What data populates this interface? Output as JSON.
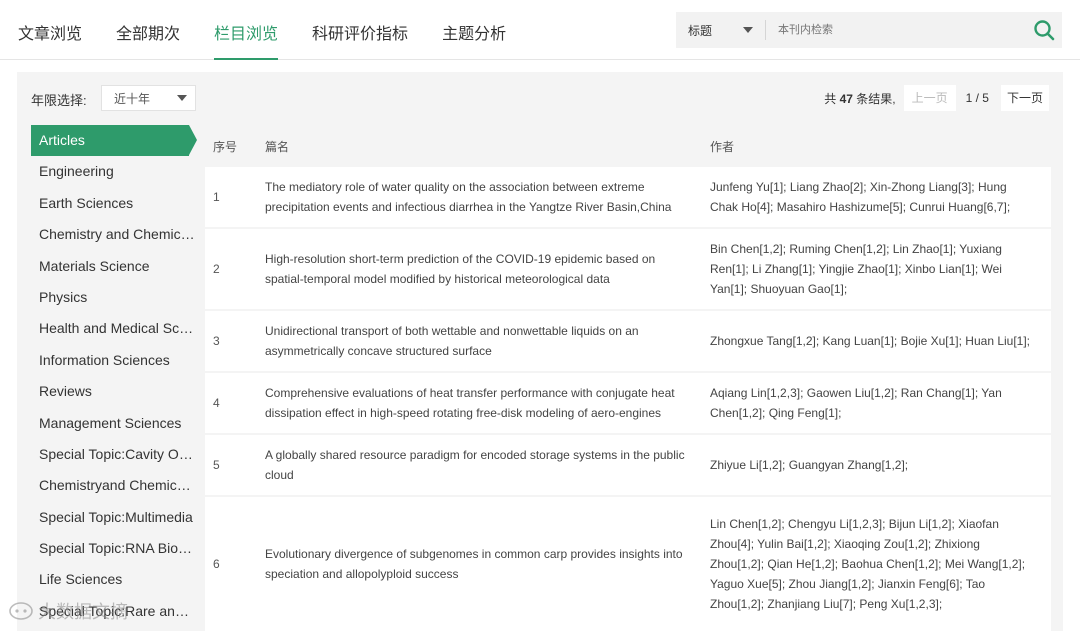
{
  "nav": {
    "tabs": [
      "文章浏览",
      "全部期次",
      "栏目浏览",
      "科研评价指标",
      "主题分析"
    ],
    "active_index": 2
  },
  "search": {
    "field": "标题",
    "placeholder": "本刊内检索"
  },
  "filter": {
    "label": "年限选择:",
    "value": "近十年"
  },
  "pager": {
    "prefix": "共",
    "total": "47",
    "suffix": "条结果,",
    "prev": "上一页",
    "page": "1 / 5",
    "next": "下一页"
  },
  "sidebar": {
    "items": [
      "Articles",
      "Engineering",
      "Earth Sciences",
      "Chemistry and Chemical Engineering",
      "Materials Science",
      "Physics",
      "Health and Medical Sciences",
      "Information Sciences",
      "Reviews",
      "Management Sciences",
      "Special Topic:Cavity Optomechanics",
      "Chemistryand Chemical Engineering",
      "Special Topic:Multimedia",
      "Special Topic:RNA Biology",
      "Life Sciences",
      "Special Topic:Rare and Precious Metals"
    ],
    "active_index": 0
  },
  "table": {
    "headers": {
      "no": "序号",
      "title": "篇名",
      "author": "作者"
    },
    "rows": [
      {
        "no": "1",
        "title": "The mediatory role of water quality on the association between extreme precipitation events and infectious diarrhea in the Yangtze River Basin,China",
        "authors": "Junfeng Yu[1]; Liang Zhao[2]; Xin-Zhong Liang[3]; Hung Chak Ho[4]; Masahiro Hashizume[5]; Cunrui Huang[6,7];"
      },
      {
        "no": "2",
        "title": "High-resolution short-term prediction of the COVID-19 epidemic based on spatial-temporal model modified by historical meteorological data",
        "authors": "Bin Chen[1,2]; Ruming Chen[1,2]; Lin Zhao[1]; Yuxiang Ren[1]; Li Zhang[1]; Yingjie Zhao[1]; Xinbo Lian[1]; Wei Yan[1]; Shuoyuan Gao[1];"
      },
      {
        "no": "3",
        "title": "Unidirectional transport of both wettable and nonwettable liquids on an asymmetrically concave structured surface",
        "authors": "Zhongxue Tang[1,2]; Kang Luan[1]; Bojie Xu[1]; Huan Liu[1];"
      },
      {
        "no": "4",
        "title": "Comprehensive evaluations of heat transfer performance with conjugate heat dissipation effect in high-speed rotating free-disk modeling of aero-engines",
        "authors": "Aqiang Lin[1,2,3]; Gaowen Liu[1,2]; Ran Chang[1]; Yan Chen[1,2]; Qing Feng[1];"
      },
      {
        "no": "5",
        "title": "A globally shared resource paradigm for encoded storage systems in the public cloud",
        "authors": "Zhiyue Li[1,2]; Guangyan Zhang[1,2];"
      },
      {
        "no": "6",
        "title": "Evolutionary divergence of subgenomes in common carp provides insights into speciation and allopolyploid success",
        "authors": "Lin Chen[1,2]; Chengyu Li[1,2,3]; Bijun Li[1,2]; Xiaofan Zhou[4]; Yulin Bai[1,2]; Xiaoqing Zou[1,2]; Zhixiong Zhou[1,2]; Qian He[1,2]; Baohua Chen[1,2]; Mei Wang[1,2]; Yaguo Xue[5]; Zhou Jiang[1,2]; Jianxin Feng[6]; Tao Zhou[1,2]; Zhanjiang Liu[7]; Peng Xu[1,2,3];"
      }
    ]
  },
  "watermark": "大数据文摘",
  "colors": {
    "accent": "#2e9b6b",
    "panel_bg": "#f4f4f4"
  }
}
